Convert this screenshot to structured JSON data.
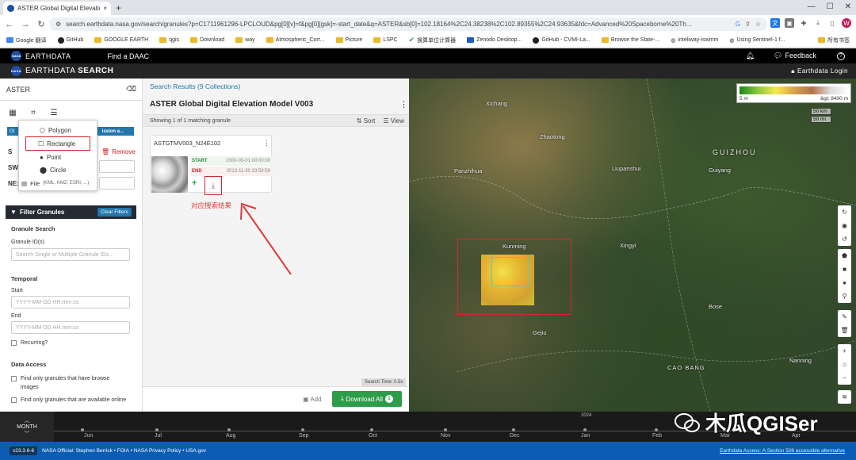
{
  "browser": {
    "tab_title": "ASTER Global Digital Elevatio",
    "tab_close": "×",
    "new_tab": "+",
    "url": "search.earthdata.nasa.gov/search/granules?p=C1711961296-LPCLOUD&pg[0][v]=f&pg[0][gsk]=-start_date&q=ASTER&sb[0]=102.18164%2C24.38238%2C102.89355%2C24.93635&fdc=Advanced%20Spaceborne%20Th...",
    "nav": {
      "back": "←",
      "forward": "→",
      "reload": "↻"
    },
    "window_controls": {
      "minimize": "—",
      "maximize": "☐",
      "close": "✕"
    },
    "profile_initial": "W",
    "bookmarks": [
      {
        "label": "Google 翻译"
      },
      {
        "label": "GitHub"
      },
      {
        "label": "GOOGLE EARTH"
      },
      {
        "label": "qgis"
      },
      {
        "label": "Download"
      },
      {
        "label": "way"
      },
      {
        "label": "Atmospheric_Corr..."
      },
      {
        "label": "Picture"
      },
      {
        "label": "LSPC"
      },
      {
        "label": "换算单位计算器"
      },
      {
        "label": "Zenodo Desktop..."
      },
      {
        "label": "GitHub - CVMI-La..."
      },
      {
        "label": "Browse the State-..."
      },
      {
        "label": "inteliway-iswmm"
      },
      {
        "label": "Using Sentinel-1 f..."
      }
    ],
    "all_bookmarks": "所有书签"
  },
  "earthdata": {
    "brand": "EARTHDATA",
    "nasa_logo_text": "NASA",
    "find_daac": "Find a DAAC",
    "feedback": "Feedback",
    "help": "?",
    "search_brand_light": "EARTHDATA",
    "search_brand_bold": "SEARCH",
    "login": "Earthdata Login"
  },
  "left": {
    "search_value": "ASTER",
    "chip_left": "Ol",
    "chip_right": "ission a...",
    "spatial_header": "S",
    "remove": "Remove",
    "sw_label": "SW:",
    "ne_label": "NE:",
    "dropdown": {
      "polygon": "Polygon",
      "rectangle": "Rectangle",
      "point": "Point",
      "circle": "Circle",
      "file": "File",
      "file_hint": "(KML, KMZ, ESRI, ...)"
    },
    "filter_title": "Filter Granules",
    "clear_filters": "Clear Filters",
    "granule_search": "Granule Search",
    "granule_ids_label": "Granule ID(s)",
    "granule_ids_placeholder": "Search Single or Multiple Granule IDs...",
    "temporal": "Temporal",
    "start_label": "Start",
    "start_placeholder": "YYYY-MM-DD HH:mm:ss",
    "end_label": "End",
    "end_placeholder": "YYYY-MM-DD HH:mm:ss",
    "recurring": "Recurring?",
    "data_access": "Data Access",
    "browse_only": "Find only granules that have browse images",
    "online_only": "Find only granules that are available online"
  },
  "results": {
    "breadcrumb": "Search Results (9 Collections)",
    "title": "ASTER Global Digital Elevation Model V003",
    "showing": "Showing 1 of 1 matching granule",
    "sort": "Sort",
    "view": "View",
    "granule": {
      "name": "ASTGTMV003_N24E102",
      "start_label": "START",
      "start_value": "2000-03-01 00:00:00",
      "end_label": "END",
      "end_value": "2013-11-30 23:59:59"
    },
    "annotation": "对应搜索结果",
    "search_time": "Search Time: 0.5s",
    "add": "Add",
    "download_all": "Download All",
    "download_count": "1"
  },
  "map": {
    "legend_min": "5 m",
    "legend_max": "&gt; 8400 m",
    "scale_km": "50 km",
    "scale_mi": "50 mi",
    "labels": {
      "xichang": "Xichang",
      "zhaotong": "Zhaotong",
      "guizhou": "GUIZHOU",
      "panzhihua": "Panzhihua",
      "liupanshui": "Liupanshui",
      "guiyang": "Guiyang",
      "kunming": "Kunming",
      "xingyi": "Xingyi",
      "bose": "Bose",
      "gejiu": "Gejiu",
      "caobang": "CAO BANG",
      "nanning": "Nanning"
    }
  },
  "timeline": {
    "mode": "MONTH",
    "year": "2024",
    "months": [
      "Jun",
      "Jul",
      "Aug",
      "Sep",
      "Oct",
      "Nov",
      "Dec",
      "Jan",
      "Feb",
      "Mar",
      "Apr"
    ]
  },
  "watermark": "木瓜QGISer",
  "footer": {
    "version": "v23.3.6-6",
    "official": "NASA Official: Stephen Berrick",
    "foia": "FOIA",
    "privacy": "NASA Privacy Policy",
    "usagov": "USA.gov",
    "accessibility": "Earthdata Access: A Section 508 accessible alternative"
  },
  "colors": {
    "earthdata_blue": "#2276ac",
    "download_green": "#2e9d4a",
    "annotation_red": "#d12a2a",
    "footer_blue": "#0b5db4"
  }
}
